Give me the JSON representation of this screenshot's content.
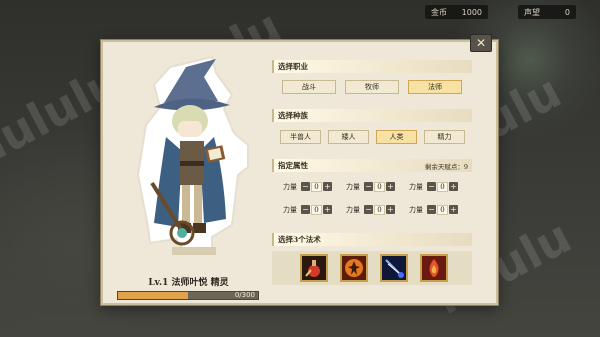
{
  "topbar": {
    "gold_label": "金币",
    "gold_value": "1000",
    "fame_label": "声望",
    "fame_value": "0"
  },
  "watermark": "lululu",
  "character": {
    "name_line": "Lv.1 法师叶悦 精灵",
    "xp_text": "0/300",
    "xp_progress": 0.5
  },
  "class_section": {
    "title": "选择职业",
    "options": [
      "战斗",
      "牧师",
      "法师"
    ],
    "selected": 2
  },
  "race_section": {
    "title": "选择种族",
    "options": [
      "半兽人",
      "矮人",
      "人类",
      "精力"
    ],
    "selected": 2
  },
  "attr_section": {
    "title": "指定属性",
    "remaining": "剩余天赋点：9",
    "stats": [
      {
        "label": "力量",
        "value": "0"
      },
      {
        "label": "力量",
        "value": "0"
      },
      {
        "label": "力量",
        "value": "0"
      },
      {
        "label": "力量",
        "value": "0"
      },
      {
        "label": "力量",
        "value": "0"
      },
      {
        "label": "力量",
        "value": "0"
      }
    ],
    "minus": "−",
    "plus": "+"
  },
  "spell_section": {
    "title": "选择3个法术",
    "spells": [
      "potion-spell-icon",
      "fire-warrior-spell-icon",
      "lightning-arrow-spell-icon",
      "flame-spell-icon"
    ]
  },
  "colors": {
    "panel": "#efe8d8",
    "selected_chip": "#f7e2a3",
    "xp_fill": "#e0a24a"
  }
}
